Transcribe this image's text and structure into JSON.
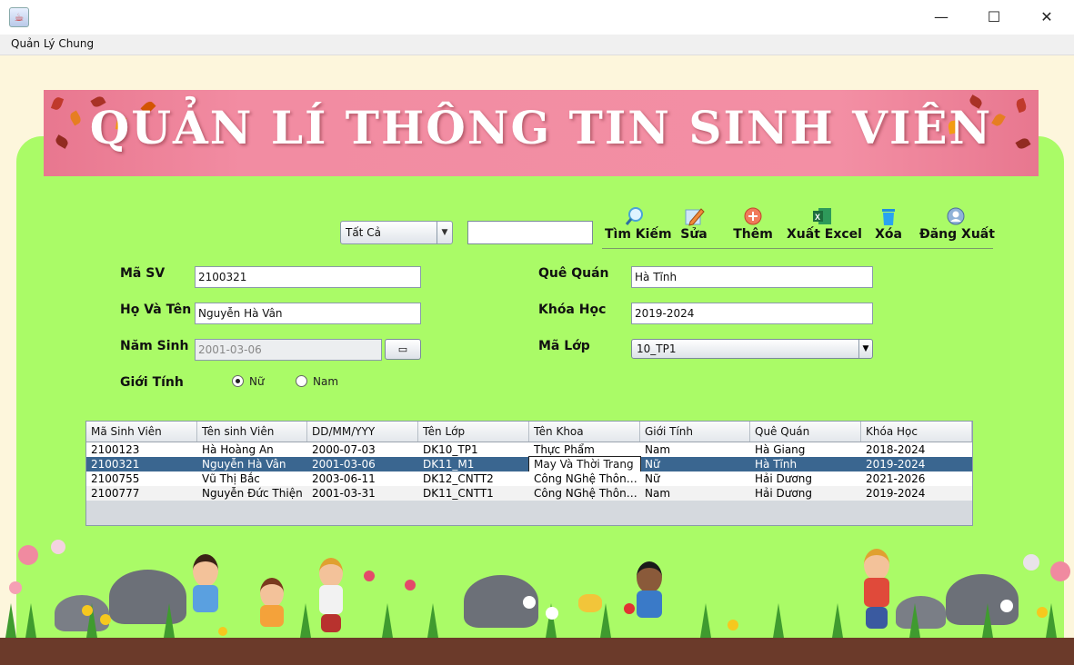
{
  "window": {
    "icon": "java-cup-icon",
    "minimize": "—",
    "maximize": "☐",
    "close": "✕"
  },
  "menu": {
    "items": [
      "Quản Lý Chung"
    ]
  },
  "banner": {
    "title": "QUẢN LÍ THÔNG TIN SINH VIÊN"
  },
  "search": {
    "filter_value": "Tất Cả",
    "query": ""
  },
  "toolbar": [
    {
      "label": "Tìm Kiếm",
      "icon": "magnifier-icon"
    },
    {
      "label": "Sửa",
      "icon": "edit-pencil-icon"
    },
    {
      "label": "Thêm",
      "icon": "add-circle-icon"
    },
    {
      "label": "Xuất Excel",
      "icon": "excel-icon"
    },
    {
      "label": "Xóa",
      "icon": "trash-icon"
    },
    {
      "label": "Đăng Xuất",
      "icon": "user-logout-icon"
    }
  ],
  "form": {
    "ma_sv_label": "Mã SV",
    "ma_sv": "2100321",
    "ho_ten_label": "Họ Và Tên",
    "ho_ten": "Nguyễn Hà Vân",
    "nam_sinh_label": "Năm Sinh",
    "nam_sinh": "2001-03-06",
    "gioi_tinh_label": "Giới Tính",
    "gioi_tinh_options": [
      "Nữ",
      "Nam"
    ],
    "gioi_tinh_selected": "Nữ",
    "que_quan_label": "Quê Quán",
    "que_quan": "Hà Tĩnh",
    "khoa_hoc_label": "Khóa Học",
    "khoa_hoc": "2019-2024",
    "ma_lop_label": "Mã Lớp",
    "ma_lop": "10_TP1"
  },
  "table": {
    "columns": [
      "Mã Sinh Viên",
      "Tên sinh Viên",
      "DD/MM/YYY",
      "Tên Lớp",
      "Tên Khoa",
      "Giới Tính",
      "Quê Quán",
      "Khóa Học"
    ],
    "rows": [
      [
        "2100123",
        "Hà Hoàng An",
        "2000-07-03",
        "DK10_TP1",
        "Thực Phẩm",
        "Nam",
        "Hà Giang",
        "2018-2024"
      ],
      [
        "2100321",
        "Nguyễn Hà Vân",
        "2001-03-06",
        "DK11_M1",
        "May Và Thời Trang",
        "Nữ",
        "Hà Tĩnh",
        "2019-2024"
      ],
      [
        "2100755",
        "Vũ Thị Bắc",
        "2003-06-11",
        "DK12_CNTT2",
        "Công NGhệ Thông...",
        "Nữ",
        "Hải Dương",
        "2021-2026"
      ],
      [
        "2100777",
        "Nguyễn Đức Thiện",
        "2001-03-31",
        "DK11_CNTT1",
        "Công NGhệ Thông...",
        "Nam",
        "Hải Dương",
        "2019-2024"
      ]
    ],
    "selected_row": 1
  },
  "colors": {
    "panel_green": "#aafb67",
    "banner_pink": "#f28ca2",
    "selection_blue": "#3a6690"
  }
}
